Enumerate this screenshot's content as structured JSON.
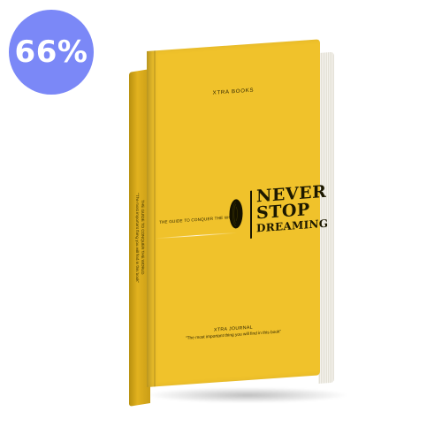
{
  "badge": {
    "discount_text": "66%",
    "color": "#7b88f7"
  },
  "book": {
    "cover_color": "#f0c22b",
    "spine_color": "#e2b21f",
    "publisher": "XTRA BOOKS",
    "tagline": "THE GUIDE TO CONQUER THE WORLD",
    "title_line1": "NEVER",
    "title_line2": "STOP",
    "title_line3": "DREAMING",
    "journal_title": "XTRA JOURNAL",
    "journal_quote": "\"The most important thing you will find in this book\"",
    "spine_line1": "THE GUIDE TO CONQUER THE WORLD",
    "spine_line2": "\"The most important thing you will find in this book\""
  }
}
